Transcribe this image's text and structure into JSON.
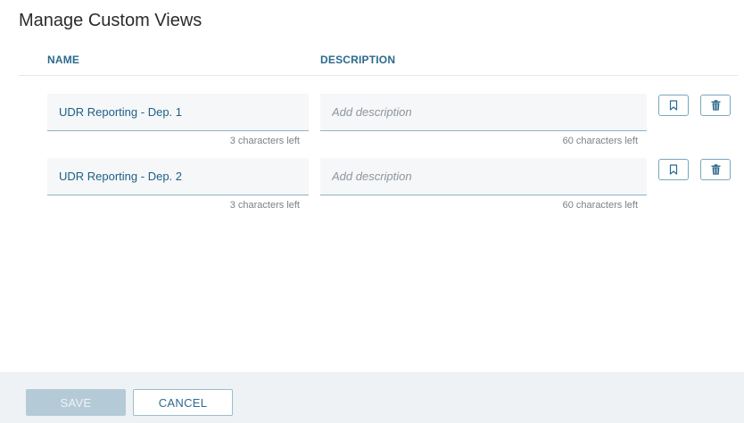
{
  "dialog": {
    "title": "Manage Custom Views"
  },
  "columns": {
    "name": "NAME",
    "description": "DESCRIPTION"
  },
  "views": [
    {
      "name": "UDR Reporting - Dep. 1",
      "description": "",
      "description_placeholder": "Add description",
      "name_counter": "3 characters left",
      "description_counter": "60 characters left"
    },
    {
      "name": "UDR Reporting - Dep. 2",
      "description": "",
      "description_placeholder": "Add description",
      "name_counter": "3 characters left",
      "description_counter": "60 characters left"
    }
  ],
  "icons": {
    "bookmark": "bookmark-icon",
    "delete": "trash-icon"
  },
  "footer": {
    "save_label": "SAVE",
    "cancel_label": "CANCEL"
  },
  "colors": {
    "accent": "#2c6a8e",
    "save_disabled_bg": "#b5cad7",
    "footer_bg": "#eef2f5"
  }
}
